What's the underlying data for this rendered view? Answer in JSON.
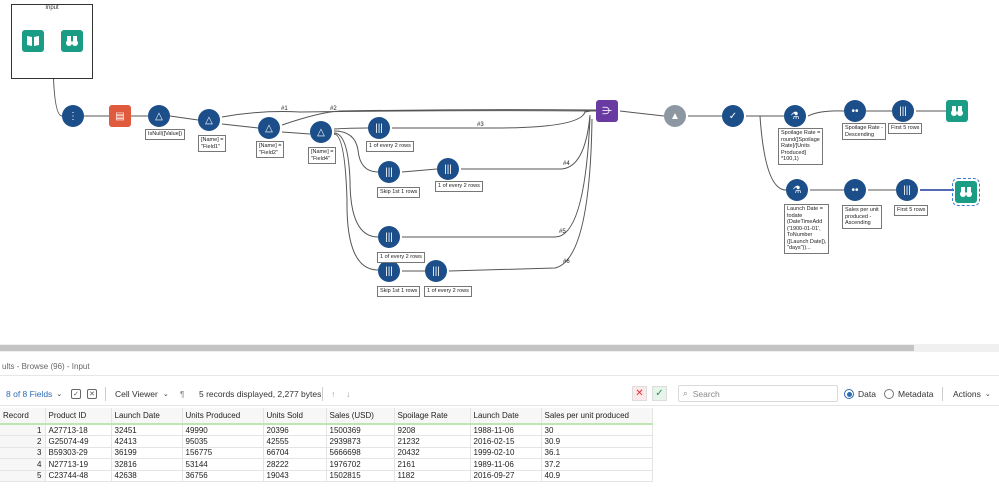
{
  "canvas": {
    "container_title": "Input",
    "annotations": {
      "isnull": "IsNull([Value])",
      "name_field1": "[Name] =\n\"Field1\"",
      "name_field2": "[Name] =\n\"Field2\"",
      "name_field4": "[Name] =\n\"Field4\"",
      "sample_a": "1 of every 2 rows",
      "skip_a": "Skip 1st 1 rows",
      "sample_b": "1 of every 2 rows",
      "sample_c": "1 of every 2 rows",
      "skip_b": "Skip 1st 1 rows",
      "sample_d": "1 of every 2 rows",
      "spoilage_formula": "Spoilage Rate =\nround([Spoilage\nRate]/[Units\nProduced]\n*100,1)",
      "sort_spoilage": "Spoilage Rate -\nDescending",
      "first5_a": "First 5 rows",
      "launch_formula": "Launch Date =\ntodate\n(DateTimeAdd\n('1900-01-01',\nToNumber\n([Launch Date]),\n\"days\"))...",
      "sort_sales": "Sales per unit\nproduced -\nAscending",
      "first5_b": "First 5 rows"
    },
    "wire_labels": {
      "w1": "#1",
      "w2": "#2",
      "w3": "#3",
      "w4": "#4",
      "w5": "#5",
      "w6": "#6"
    }
  },
  "results": {
    "header_prefix": "ults",
    "header_rest": " - Browse (96) - Input",
    "fields_selector": "8 of 8 Fields",
    "cell_viewer": "Cell Viewer",
    "records_info": "5 records displayed, 2,277 bytes",
    "search_placeholder": "Search",
    "data_label": "Data",
    "metadata_label": "Metadata",
    "actions_label": "Actions"
  },
  "table": {
    "columns": [
      "Record",
      "Product ID",
      "Launch Date",
      "Units Produced",
      "Units Sold",
      "Sales (USD)",
      "Spoilage Rate",
      "Launch Date",
      "Sales per unit produced"
    ],
    "rows": [
      [
        "1",
        "A27713-18",
        "32451",
        "49990",
        "20396",
        "1500369",
        "9208",
        "1988-11-06",
        "30"
      ],
      [
        "2",
        "G25074-49",
        "42413",
        "95035",
        "42555",
        "2939873",
        "21232",
        "2016-02-15",
        "30.9"
      ],
      [
        "3",
        "B59303-29",
        "36199",
        "156775",
        "66704",
        "5666698",
        "20432",
        "1999-02-10",
        "36.1"
      ],
      [
        "4",
        "N27713-19",
        "32816",
        "53144",
        "28222",
        "1976702",
        "2161",
        "1989-11-06",
        "37.2"
      ],
      [
        "5",
        "C23744-48",
        "42638",
        "36756",
        "19043",
        "1502815",
        "1182",
        "2016-09-27",
        "40.9"
      ]
    ]
  }
}
